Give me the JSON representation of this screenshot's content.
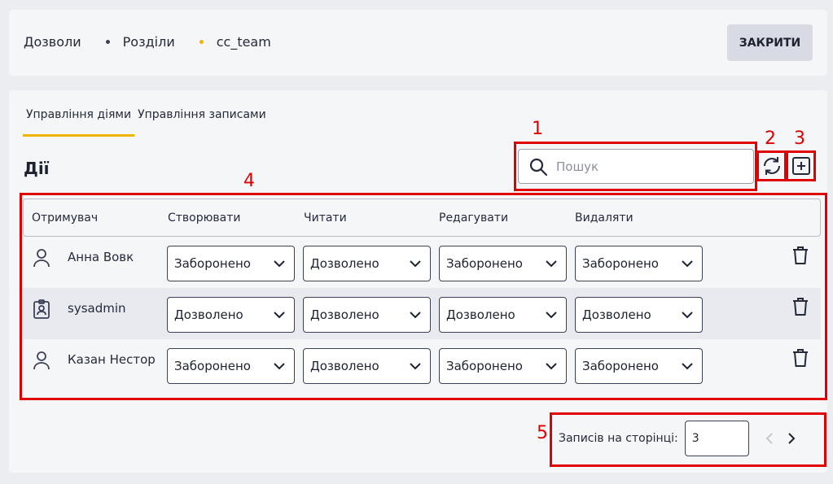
{
  "breadcrumb": {
    "items": [
      "Дозволи",
      "Розділи",
      "cc_team"
    ]
  },
  "header": {
    "close_label": "ЗАКРИТИ"
  },
  "tabs": [
    {
      "label": "Управління діями",
      "active": true
    },
    {
      "label": "Управління записами",
      "active": false
    }
  ],
  "section": {
    "title": "Дії"
  },
  "search": {
    "placeholder": "Пошук",
    "value": ""
  },
  "table": {
    "columns": [
      "Отримувач",
      "Створювати",
      "Читати",
      "Редагувати",
      "Видаляти"
    ],
    "rows": [
      {
        "icon": "person-icon",
        "name": "Анна Вовк",
        "create": "Заборонено",
        "read": "Дозволено",
        "edit": "Заборонено",
        "delete": "Заборонено"
      },
      {
        "icon": "badge-icon",
        "name": "sysadmin",
        "create": "Дозволено",
        "read": "Дозволено",
        "edit": "Дозволено",
        "delete": "Дозволено"
      },
      {
        "icon": "person-icon",
        "name": "Казан Нестор",
        "create": "Заборонено",
        "read": "Дозволено",
        "edit": "Заборонено",
        "delete": "Заборонено"
      }
    ]
  },
  "pagination": {
    "label": "Записів на сторінці:",
    "per_page": "3"
  },
  "annotations": [
    "1",
    "2",
    "3",
    "4",
    "5"
  ],
  "colors": {
    "accent": "#f0b400",
    "annotation": "#e00000"
  }
}
